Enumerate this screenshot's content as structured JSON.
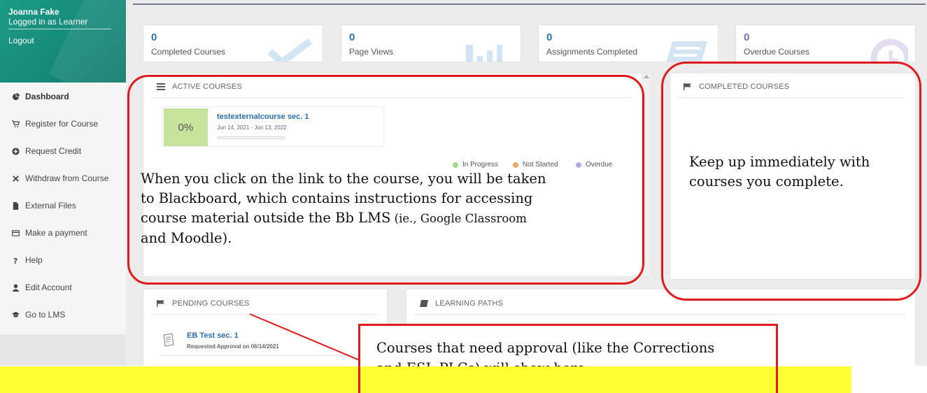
{
  "user": {
    "name": "Joanna Fake",
    "role": "Logged in as Learner",
    "logout": "Logout"
  },
  "sidebar": {
    "items": [
      {
        "label": "Dashboard",
        "icon": "pie-chart-icon"
      },
      {
        "label": "Register for Course",
        "icon": "cart-icon"
      },
      {
        "label": "Request Credit",
        "icon": "plus-circle-icon"
      },
      {
        "label": "Withdraw from Course",
        "icon": "x-icon"
      },
      {
        "label": "External Files",
        "icon": "file-icon"
      },
      {
        "label": "Make a payment",
        "icon": "credit-card-icon"
      },
      {
        "label": "Help",
        "icon": "question-icon"
      },
      {
        "label": "Edit Account",
        "icon": "user-icon"
      },
      {
        "label": "Go to LMS",
        "icon": "graduation-cap-icon"
      }
    ]
  },
  "stats": [
    {
      "value": "0",
      "label": "Completed Courses",
      "icon": "check-icon"
    },
    {
      "value": "0",
      "label": "Page Views",
      "icon": "bar-chart-icon"
    },
    {
      "value": "0",
      "label": "Assignments Completed",
      "icon": "doc-icon"
    },
    {
      "value": "0",
      "label": "Overdue Courses",
      "icon": "clock-icon"
    }
  ],
  "active_courses": {
    "title": "ACTIVE COURSES",
    "course": {
      "percent": "0%",
      "name": "testexternalcourse sec. 1",
      "dates": "Jun 14, 2021 - Jun 13, 2022",
      "progress": 0
    },
    "legend": [
      {
        "label": "In Progress",
        "color": "#a6d785"
      },
      {
        "label": "Not Started",
        "color": "#f0a96a"
      },
      {
        "label": "Overdue",
        "color": "#b9a9e0"
      }
    ]
  },
  "completed_courses": {
    "title": "COMPLETED COURSES"
  },
  "pending_courses": {
    "title": "PENDING COURSES",
    "course": {
      "name": "EB Test sec. 1",
      "status": "Requested Approval on 06/14/2021"
    }
  },
  "learning_paths": {
    "title": "LEARNING PATHS"
  },
  "annotations": {
    "active_line1": "When you click on the link to the course, you will be taken",
    "active_line2": "to Blackboard, which contains instructions for accessing",
    "active_line3a": "course material outside the Bb LMS",
    "active_line3b": " (ie., Google Classroom",
    "active_line4": "and Moodle).",
    "completed_line1": "Keep up immediately with",
    "completed_line2": "courses you complete.",
    "pending_line1": "Courses that need approval (like the Corrections",
    "pending_line2": "and ESL PLCs) will show here."
  },
  "colors": {
    "accent": "#1b9c86",
    "link": "#2a6fb1",
    "annotation": "#e01b1b",
    "highlight": "#ffff33"
  }
}
